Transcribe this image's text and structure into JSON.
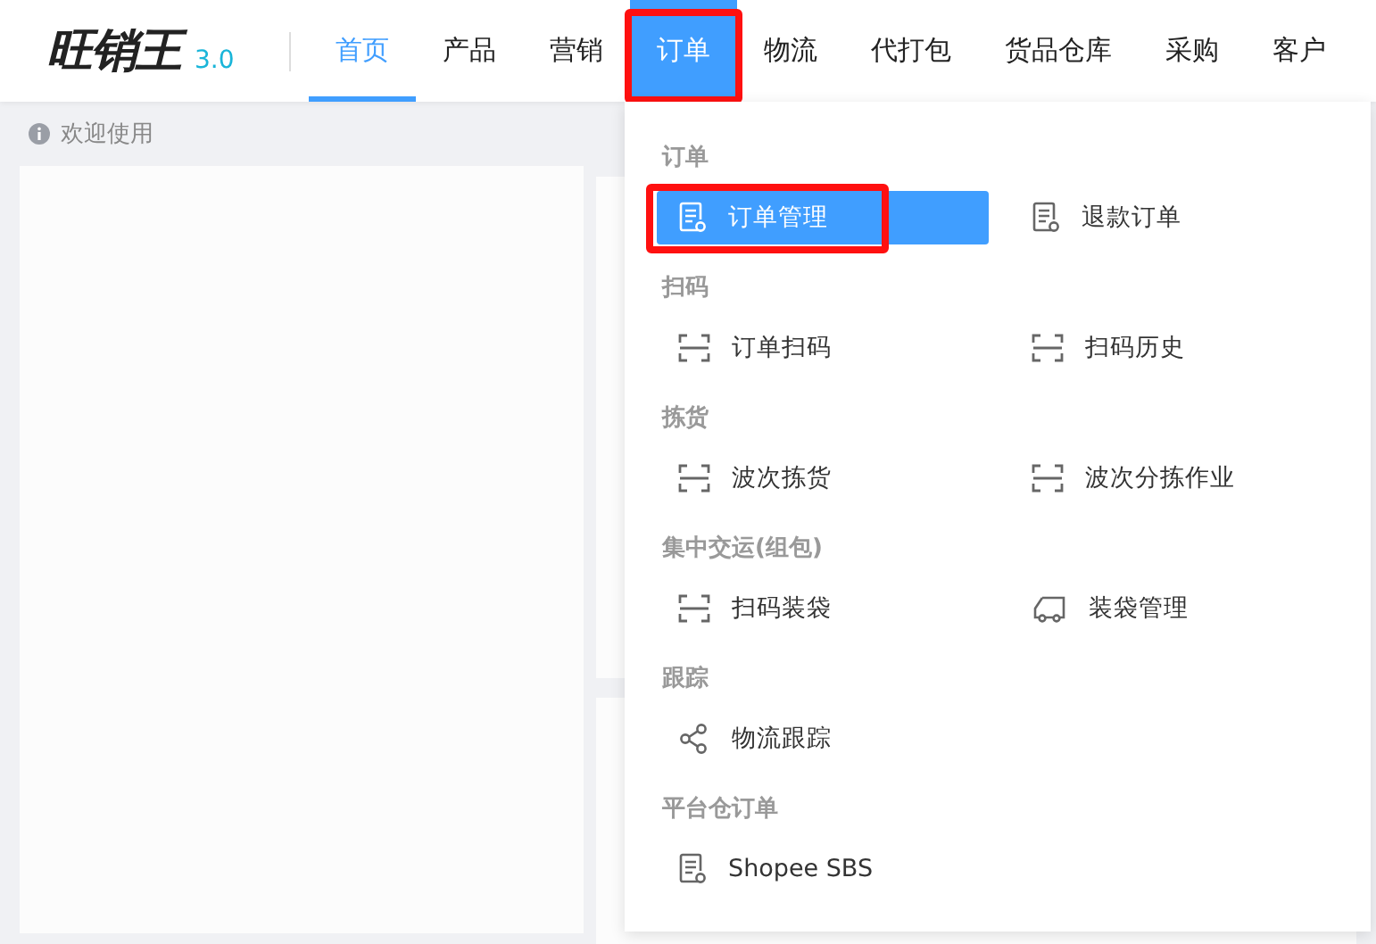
{
  "logo": {
    "name": "旺销王",
    "version": "3.0"
  },
  "nav": [
    {
      "label": "首页",
      "selected": true,
      "expanded": false,
      "highlighted": false
    },
    {
      "label": "产品",
      "selected": false,
      "expanded": false,
      "highlighted": false
    },
    {
      "label": "营销",
      "selected": false,
      "expanded": false,
      "highlighted": false
    },
    {
      "label": "订单",
      "selected": false,
      "expanded": true,
      "highlighted": true
    },
    {
      "label": "物流",
      "selected": false,
      "expanded": false,
      "highlighted": false
    },
    {
      "label": "代打包",
      "selected": false,
      "expanded": false,
      "highlighted": false
    },
    {
      "label": "货品仓库",
      "selected": false,
      "expanded": false,
      "highlighted": false
    },
    {
      "label": "采购",
      "selected": false,
      "expanded": false,
      "highlighted": false
    },
    {
      "label": "客户",
      "selected": false,
      "expanded": false,
      "highlighted": false
    }
  ],
  "welcome": "欢迎使用",
  "menu": {
    "groups": [
      {
        "title": "订单",
        "items": [
          {
            "label": "订单管理",
            "kind": "document",
            "selected": true,
            "highlighted": true
          },
          {
            "label": "退款订单",
            "kind": "document",
            "selected": false,
            "highlighted": false
          }
        ]
      },
      {
        "title": "扫码",
        "items": [
          {
            "label": "订单扫码",
            "kind": "scan",
            "selected": false,
            "highlighted": false
          },
          {
            "label": "扫码历史",
            "kind": "scan",
            "selected": false,
            "highlighted": false
          }
        ]
      },
      {
        "title": "拣货",
        "items": [
          {
            "label": "波次拣货",
            "kind": "scan",
            "selected": false,
            "highlighted": false
          },
          {
            "label": "波次分拣作业",
            "kind": "scan",
            "selected": false,
            "highlighted": false
          }
        ]
      },
      {
        "title": "集中交运(组包)",
        "items": [
          {
            "label": "扫码装袋",
            "kind": "scan",
            "selected": false,
            "highlighted": false
          },
          {
            "label": "装袋管理",
            "kind": "truck",
            "selected": false,
            "highlighted": false
          }
        ]
      },
      {
        "title": "跟踪",
        "items": [
          {
            "label": "物流跟踪",
            "kind": "share",
            "selected": false,
            "highlighted": false
          }
        ]
      },
      {
        "title": "平台仓订单",
        "items": [
          {
            "label": "Shopee SBS",
            "kind": "document",
            "selected": false,
            "highlighted": false
          }
        ]
      }
    ]
  }
}
